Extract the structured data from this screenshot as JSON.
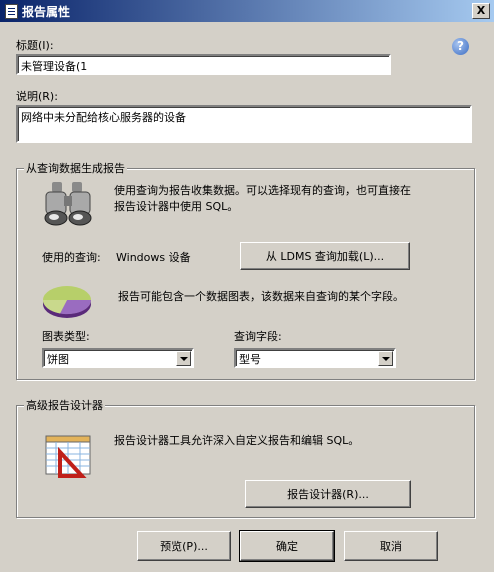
{
  "window": {
    "title": "报告属性",
    "close_glyph": "X"
  },
  "help_glyph": "?",
  "title_field": {
    "label": "标题(I):",
    "value": "未管理设备(1"
  },
  "description_field": {
    "label": "说明(R):",
    "value": "网络中未分配给核心服务器的设备"
  },
  "query_group": {
    "legend": "从查询数据生成报告",
    "intro_line1": "使用查询为报告收集数据。可以选择现有的查询，也可直接在",
    "intro_line2": "报告设计器中使用 SQL。",
    "query_used_label": "使用的查询:",
    "query_used_value": "Windows 设备",
    "load_button": "从 LDMS 查询加载(L)...",
    "chart_description": "报告可能包含一个数据图表，该数据来自查询的某个字段。",
    "chart_type_label": "图表类型:",
    "chart_type_value": "饼图",
    "query_field_label": "查询字段:",
    "query_field_value": "型号"
  },
  "advanced_group": {
    "legend": "高级报告设计器",
    "description": "报告设计器工具允许深入自定义报告和编辑 SQL。",
    "designer_button": "报告设计器(R)..."
  },
  "footer": {
    "preview": "预览(P)...",
    "ok": "确定",
    "cancel": "取消"
  },
  "colors": {
    "titlebar_start": "#0a246a",
    "titlebar_end": "#a6caf0",
    "face": "#d4d0c8"
  }
}
